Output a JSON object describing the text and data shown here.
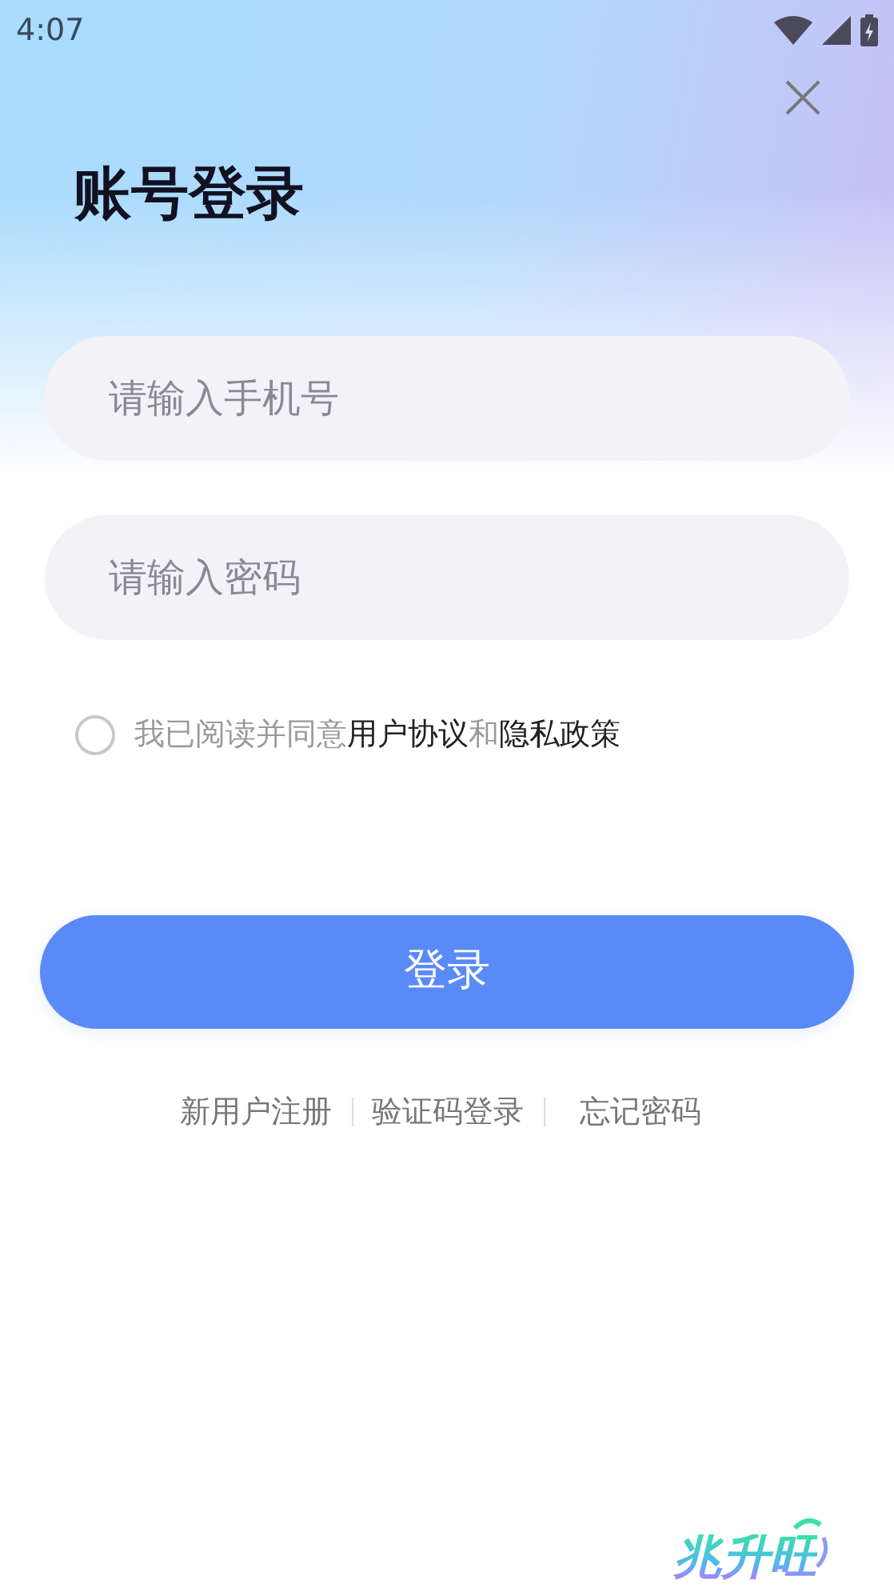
{
  "status_bar": {
    "time": "4:07"
  },
  "title": "账号登录",
  "fields": [
    {
      "placeholder": "请输入手机号"
    },
    {
      "placeholder": "请输入密码"
    }
  ],
  "agreement": {
    "checked": false,
    "parts": [
      {
        "text": "我已阅读并同意",
        "kind": "plain"
      },
      {
        "text": "用户协议",
        "kind": "link"
      },
      {
        "text": "和",
        "kind": "plain"
      },
      {
        "text": "隐私政策",
        "kind": "link"
      }
    ]
  },
  "login_button": "登录",
  "links": [
    "新用户注册",
    "验证码登录",
    "忘记密码"
  ],
  "logo": "兆升旺"
}
